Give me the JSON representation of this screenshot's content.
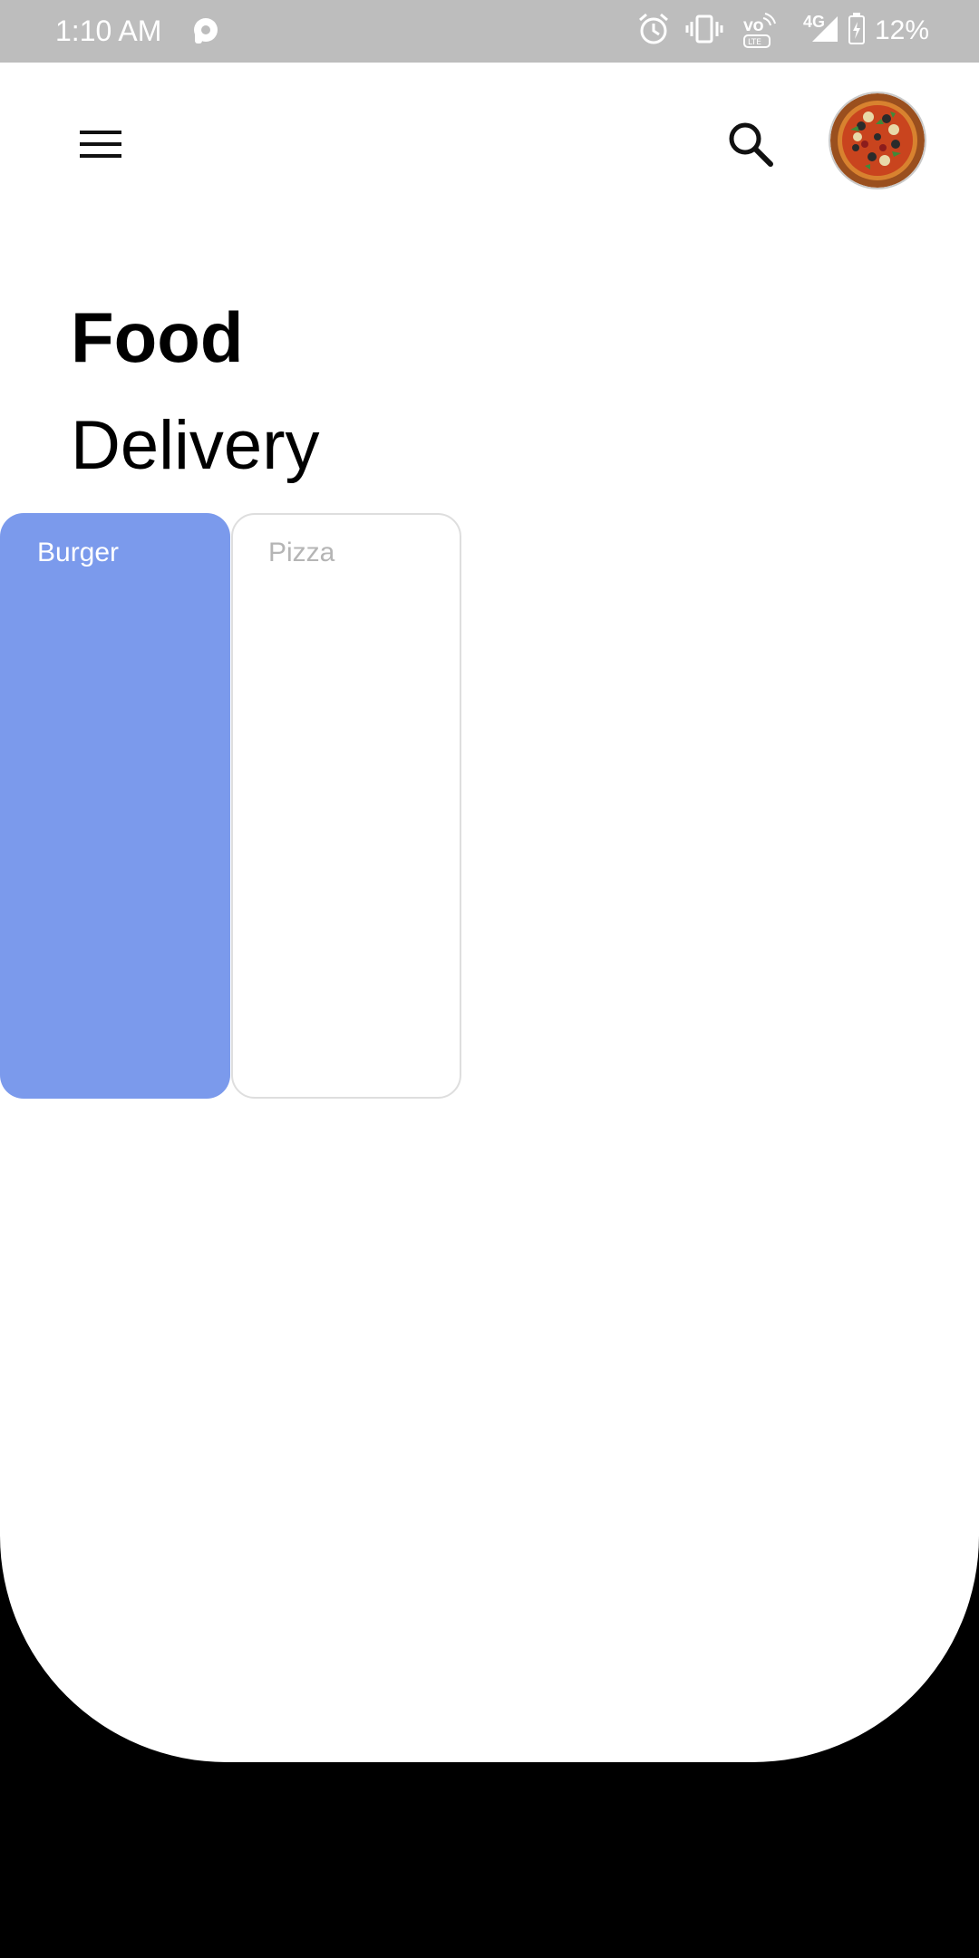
{
  "status_bar": {
    "time": "1:10 AM",
    "network": "4G",
    "battery": "12%",
    "icons": [
      "alarm-icon",
      "vibrate-icon",
      "volte-icon",
      "signal-icon",
      "battery-icon"
    ]
  },
  "header": {
    "menu_icon": "menu-icon",
    "search_icon": "search-icon",
    "avatar": "pizza-avatar"
  },
  "title": {
    "line1": "Food",
    "line2": "Delivery"
  },
  "categories": [
    {
      "label": "Burger",
      "selected": true
    },
    {
      "label": "Pizza",
      "selected": false
    }
  ],
  "colors": {
    "accent": "#7b9aec",
    "status_bar": "#bdbdbd",
    "background": "#ffffff",
    "inactive_text": "#b5b5b5"
  }
}
